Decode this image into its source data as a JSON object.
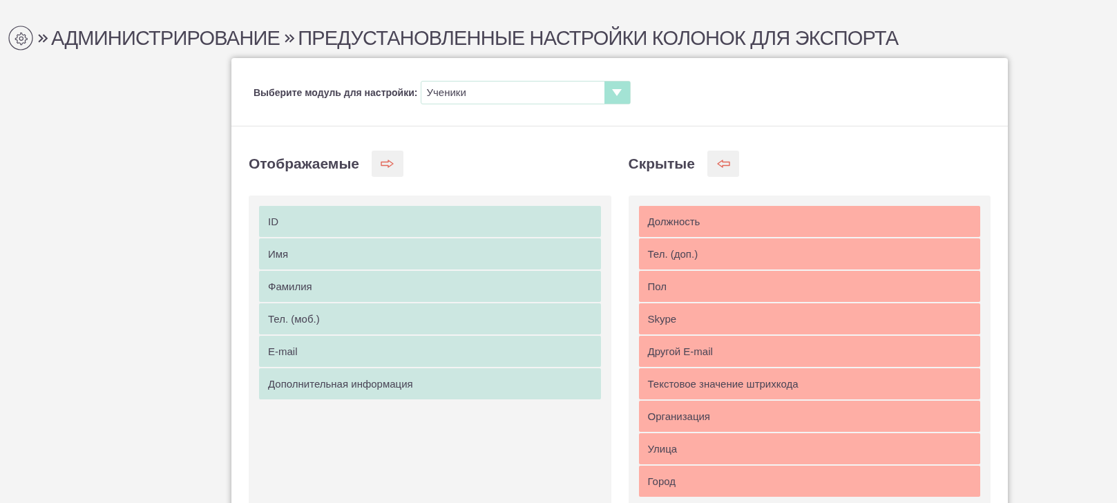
{
  "breadcrumb": [
    "АДМИНИСТРИРОВАНИЕ",
    "ПРЕДУСТАНОВЛЕННЫЕ НАСТРОЙКИ КОЛОНОК ДЛЯ ЭКСПОРТА"
  ],
  "module_select": {
    "label": "Выберите модуль для настройки:",
    "value": "Ученики"
  },
  "columns": [
    {
      "kind": "shown",
      "title": "Отображаемые",
      "items": [
        "ID",
        "Имя",
        "Фамилия",
        "Тел. (моб.)",
        "E-mail",
        "Дополнительная информация"
      ]
    },
    {
      "kind": "hidden",
      "title": "Скрытые",
      "items": [
        "Должность",
        "Тел. (доп.)",
        "Пол",
        "Skype",
        "Другой E-mail",
        "Текстовое значение штрихкода",
        "Организация",
        "Улица",
        "Город"
      ]
    }
  ]
}
